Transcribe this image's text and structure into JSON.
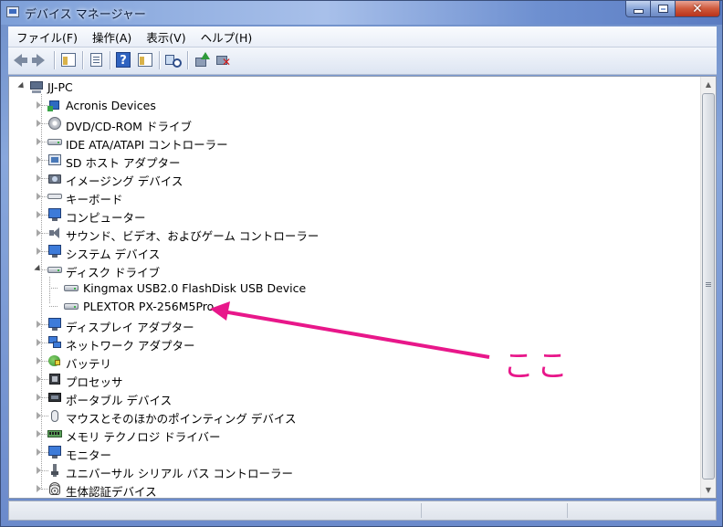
{
  "window": {
    "title": "デバイス マネージャー",
    "controls": {
      "minimize": "minimize",
      "maximize": "maximize",
      "close": "close"
    }
  },
  "menu": {
    "items": [
      {
        "label": "ファイル(F)"
      },
      {
        "label": "操作(A)"
      },
      {
        "label": "表示(V)"
      },
      {
        "label": "ヘルプ(H)"
      }
    ]
  },
  "toolbar": {
    "buttons": [
      {
        "icon": "back-arrow-icon"
      },
      {
        "icon": "forward-arrow-icon"
      },
      {
        "icon": "console-tree-icon"
      },
      {
        "icon": "properties-icon"
      },
      {
        "icon": "help-icon"
      },
      {
        "icon": "action-pane-icon"
      },
      {
        "icon": "scan-hardware-icon"
      },
      {
        "icon": "update-driver-icon"
      },
      {
        "icon": "uninstall-device-icon"
      }
    ]
  },
  "tree": {
    "root": "JJ-PC",
    "categories": [
      {
        "label": "Acronis Devices",
        "icon": "chip-icon"
      },
      {
        "label": "DVD/CD-ROM ドライブ",
        "icon": "disc-icon"
      },
      {
        "label": "IDE ATA/ATAPI コントローラー",
        "icon": "drive-icon"
      },
      {
        "label": "SD ホスト アダプター",
        "icon": "card-icon"
      },
      {
        "label": "イメージング デバイス",
        "icon": "camera-icon"
      },
      {
        "label": "キーボード",
        "icon": "keyboard-icon"
      },
      {
        "label": "コンピューター",
        "icon": "monitor-icon"
      },
      {
        "label": "サウンド、ビデオ、およびゲーム コントローラー",
        "icon": "speaker-icon"
      },
      {
        "label": "システム デバイス",
        "icon": "monitor-icon"
      },
      {
        "label": "ディスク ドライブ",
        "icon": "drive-icon",
        "expanded": true,
        "children": [
          {
            "label": "Kingmax USB2.0 FlashDisk USB Device"
          },
          {
            "label": "PLEXTOR PX-256M5Pro"
          }
        ]
      },
      {
        "label": "ディスプレイ アダプター",
        "icon": "monitor-icon"
      },
      {
        "label": "ネットワーク アダプター",
        "icon": "network-icon"
      },
      {
        "label": "バッテリ",
        "icon": "battery-icon"
      },
      {
        "label": "プロセッサ",
        "icon": "cpu-icon"
      },
      {
        "label": "ポータブル デバイス",
        "icon": "portable-icon"
      },
      {
        "label": "マウスとそのほかのポインティング デバイス",
        "icon": "mouse-icon"
      },
      {
        "label": "メモリ テクノロジ ドライバー",
        "icon": "memory-icon"
      },
      {
        "label": "モニター",
        "icon": "monitor-icon"
      },
      {
        "label": "ユニバーサル シリアル バス コントローラー",
        "icon": "usb-icon"
      },
      {
        "label": "生体認証デバイス",
        "icon": "fingerprint-icon"
      }
    ]
  },
  "annotation": {
    "text": "ここ",
    "color": "#e8178a"
  },
  "colors": {
    "title_bar": "#7d9fd8",
    "close_button": "#cf5a3c",
    "annotation": "#e8178a"
  }
}
